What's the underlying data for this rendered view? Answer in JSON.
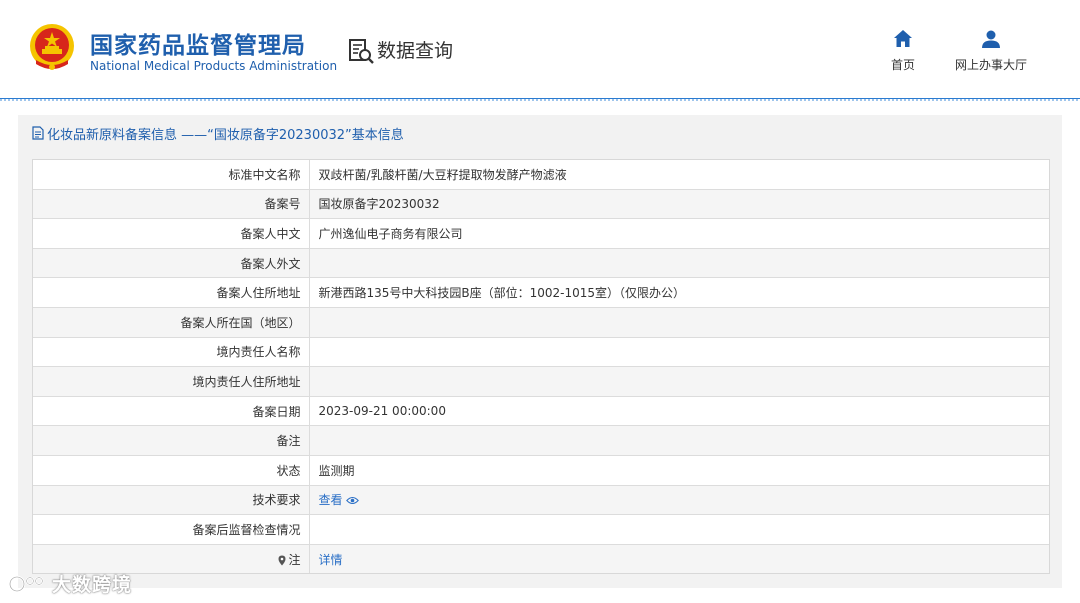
{
  "header": {
    "org_name_cn": "国家药品监督管理局",
    "org_name_en": "National Medical Products Administration",
    "section_title": "数据查询",
    "nav": [
      {
        "label": "首页",
        "icon": "home-icon"
      },
      {
        "label": "网上办事大厅",
        "icon": "user-icon"
      }
    ]
  },
  "panel": {
    "title": "化妆品新原料备案信息 ——“国妆原备字20230032”基本信息"
  },
  "rows": [
    {
      "key": "标准中文名称",
      "value": "双歧杆菌/乳酸杆菌/大豆籽提取物发酵产物滤液"
    },
    {
      "key": "备案号",
      "value": "国妆原备字20230032"
    },
    {
      "key": "备案人中文",
      "value": "广州逸仙电子商务有限公司"
    },
    {
      "key": "备案人外文",
      "value": ""
    },
    {
      "key": "备案人住所地址",
      "value": "新港西路135号中大科技园B座（部位：1002-1015室）（仅限办公）"
    },
    {
      "key": "备案人所在国（地区）",
      "value": ""
    },
    {
      "key": "境内责任人名称",
      "value": ""
    },
    {
      "key": "境内责任人住所地址",
      "value": ""
    },
    {
      "key": "备案日期",
      "value": "2023-09-21 00:00:00"
    },
    {
      "key": "备注",
      "value": ""
    },
    {
      "key": "状态",
      "value": "监测期"
    },
    {
      "key": "技术要求",
      "value": "查看"
    },
    {
      "key": "备案后监督检查情况",
      "value": ""
    },
    {
      "key": "注",
      "value": "详情"
    }
  ],
  "watermark": "大数跨境",
  "colors": {
    "brand_blue": "#1f5fad",
    "link_blue": "#2a6fc6",
    "emblem_red": "#d7261b",
    "emblem_gold": "#f5c400"
  }
}
